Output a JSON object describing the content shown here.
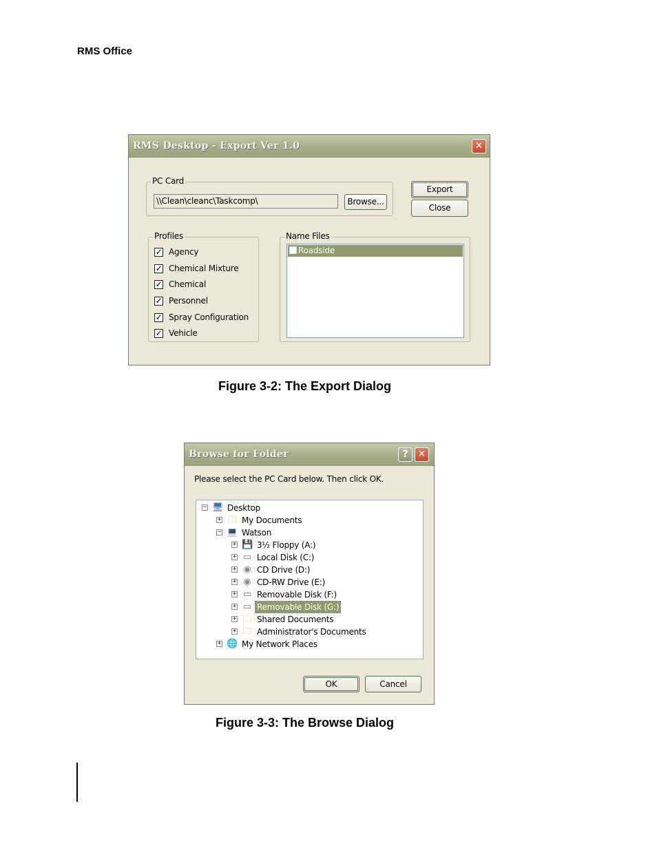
{
  "page_header": "RMS Office",
  "export_dialog": {
    "title": "RMS Desktop - Export Ver 1.0",
    "pc_card": {
      "legend": "PC Card",
      "path_value": "\\\\Clean\\cleanc\\Taskcomp\\",
      "browse_label": "Browse..."
    },
    "export_label": "Export",
    "close_label": "Close",
    "profiles": {
      "legend": "Profiles",
      "items": [
        {
          "label": "Agency",
          "checked": true
        },
        {
          "label": "Chemical Mixture",
          "checked": true
        },
        {
          "label": "Chemical",
          "checked": true
        },
        {
          "label": "Personnel",
          "checked": true
        },
        {
          "label": "Spray Configuration",
          "checked": true
        },
        {
          "label": "Vehicle",
          "checked": true
        }
      ]
    },
    "name_files": {
      "legend": "Name Files",
      "items": [
        {
          "label": "Roadside",
          "checked": false,
          "selected": true
        }
      ]
    },
    "caption": "Figure 3-2: The Export Dialog"
  },
  "browse_dialog": {
    "title": "Browse for Folder",
    "instruction": "Please select the PC Card below.  Then click OK.",
    "tree": [
      {
        "label": "Desktop",
        "icon": "desktop-icon",
        "expander": "minus"
      },
      {
        "label": "My Documents",
        "icon": "folder-icon",
        "expander": "plus"
      },
      {
        "label": "Watson",
        "icon": "computer-icon",
        "expander": "minus"
      },
      {
        "label": "3½ Floppy (A:)",
        "icon": "floppy-icon",
        "expander": "plus"
      },
      {
        "label": "Local Disk (C:)",
        "icon": "hard-disk-icon",
        "expander": "plus"
      },
      {
        "label": "CD Drive (D:)",
        "icon": "cd-drive-icon",
        "expander": "plus"
      },
      {
        "label": "CD-RW Drive (E:)",
        "icon": "cd-drive-icon",
        "expander": "plus"
      },
      {
        "label": "Removable Disk (F:)",
        "icon": "removable-disk-icon",
        "expander": "plus"
      },
      {
        "label": "Removable Disk (G:)",
        "icon": "removable-disk-icon",
        "expander": "plus",
        "selected": true
      },
      {
        "label": "Shared Documents",
        "icon": "folder-icon",
        "expander": "plus"
      },
      {
        "label": "Administrator's Documents",
        "icon": "folder-icon",
        "expander": "plus"
      },
      {
        "label": "My Network Places",
        "icon": "network-icon",
        "expander": "plus"
      }
    ],
    "ok_label": "OK",
    "cancel_label": "Cancel",
    "caption": "Figure 3-3: The Browse Dialog"
  },
  "colors": {
    "titlebar": "#a8ae8a",
    "selection": "#8f9a6d",
    "dialog_face": "#ece9d8",
    "close_button": "#c8482b"
  }
}
